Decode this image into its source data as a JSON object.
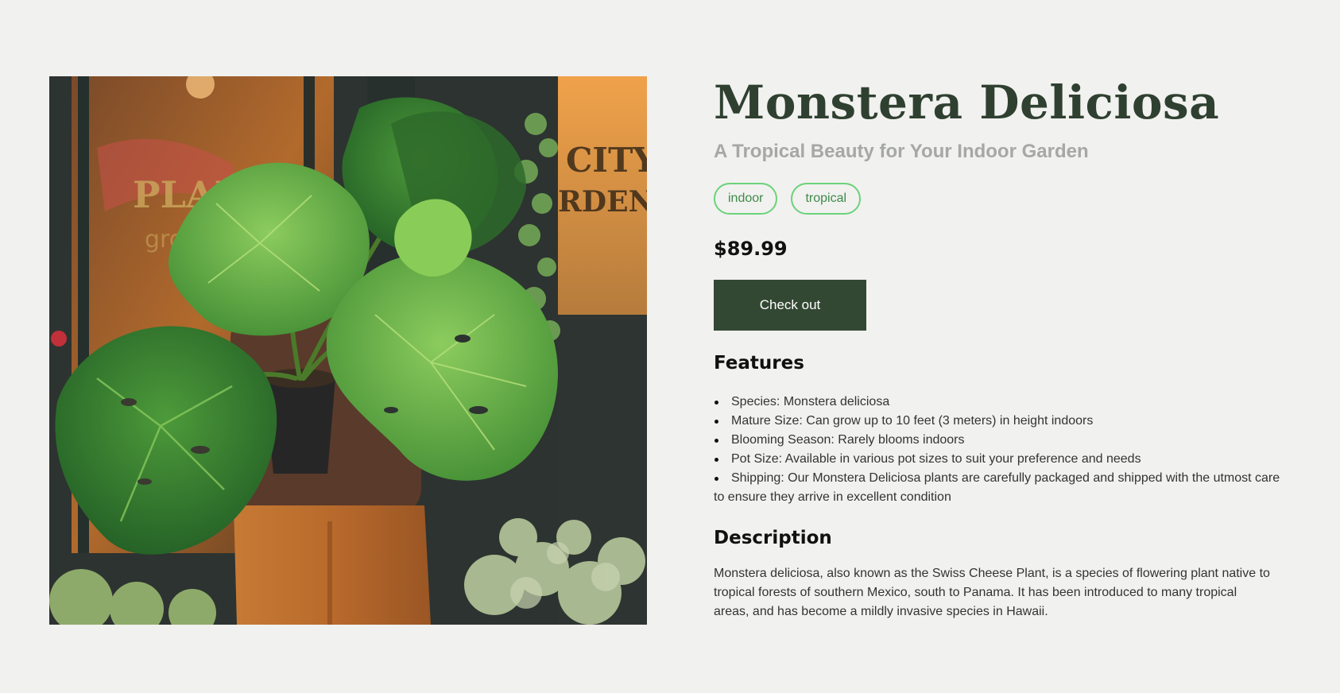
{
  "product": {
    "title": "Monstera Deliciosa",
    "subtitle": "A Tropical Beauty for Your Indoor Garden",
    "tags": [
      "indoor",
      "tropical"
    ],
    "price": "$89.99",
    "checkout_label": "Check out",
    "image_icon": "monstera-plant-photo"
  },
  "features": {
    "heading": "Features",
    "items": [
      "Species: Monstera deliciosa",
      "Mature Size: Can grow up to 10 feet (3 meters) in height indoors",
      "Blooming Season: Rarely blooms indoors",
      "Pot Size: Available in various pot sizes to suit your preference and needs",
      "Shipping: Our Monstera Deliciosa plants are carefully packaged and shipped with the utmost care to ensure they arrive in excellent condition"
    ]
  },
  "description": {
    "heading": "Description",
    "text": "Monstera deliciosa, also known as the Swiss Cheese Plant, is a species of flowering plant native to tropical forests of southern Mexico, south to Panama. It has been introduced to many tropical areas, and has become a mildly invasive species in Hawaii."
  },
  "colors": {
    "background": "#f1f1ef",
    "title": "#2f4030",
    "subtitle": "#a6a8a3",
    "tag_border": "#6bd27a",
    "tag_text": "#3f8a4a",
    "button": "#334833",
    "button_text": "#ffffff"
  }
}
